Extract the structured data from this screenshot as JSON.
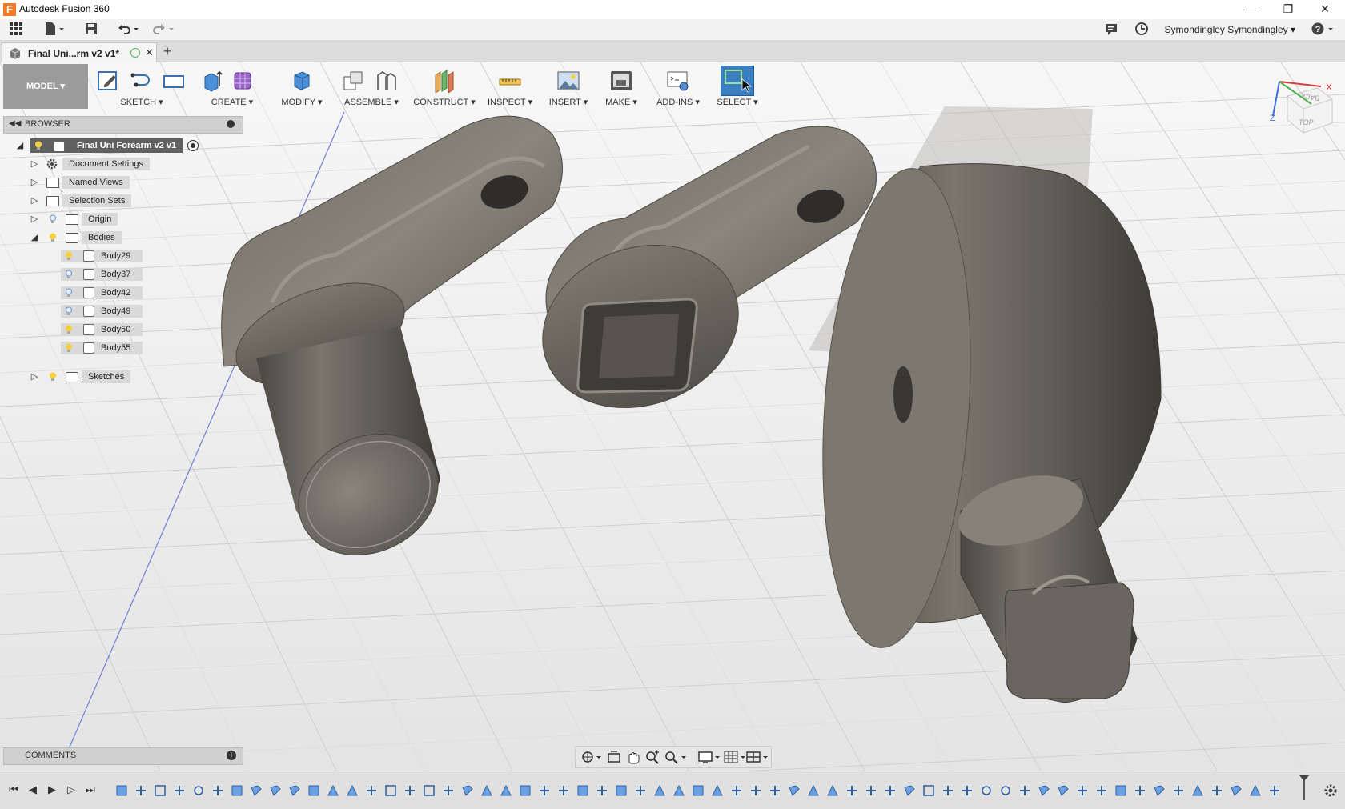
{
  "window": {
    "app_title": "Autodesk Fusion 360",
    "logo_letter": "F"
  },
  "qab": {
    "user_name": "Symondingley Symondingley ▾",
    "help_label": "?"
  },
  "doc_tab": {
    "title": "Final Uni...rm v2 v1*",
    "close_glyph": "✕",
    "new_tab_glyph": "+"
  },
  "toolbar": {
    "model_label": "MODEL ▾",
    "groups": [
      {
        "label": "SKETCH ▾"
      },
      {
        "label": "CREATE ▾"
      },
      {
        "label": "MODIFY ▾"
      },
      {
        "label": "ASSEMBLE ▾"
      },
      {
        "label": "CONSTRUCT ▾"
      },
      {
        "label": "INSPECT ▾"
      },
      {
        "label": "INSERT ▾"
      },
      {
        "label": "MAKE ▾"
      },
      {
        "label": "ADD-INS ▾"
      },
      {
        "label": "SELECT ▾"
      }
    ]
  },
  "browser": {
    "header": "BROWSER",
    "root": "Final Uni Forearm v2 v1",
    "items": [
      {
        "label": "Document Settings"
      },
      {
        "label": "Named Views"
      },
      {
        "label": "Selection Sets"
      },
      {
        "label": "Origin"
      },
      {
        "label": "Bodies"
      },
      {
        "label": "Sketches"
      }
    ],
    "bodies": [
      {
        "label": "Body29"
      },
      {
        "label": "Body37"
      },
      {
        "label": "Body42"
      },
      {
        "label": "Body49"
      },
      {
        "label": "Body50"
      },
      {
        "label": "Body55"
      }
    ]
  },
  "comments": {
    "header": "COMMENTS"
  },
  "viewcube": {
    "top": "TOP",
    "back": "BACK",
    "x": "X",
    "z": "Z"
  },
  "colors": {
    "accent_orange": "#f27a26",
    "model_gray": "#6a665f",
    "select_blue": "#3a7fbf"
  }
}
